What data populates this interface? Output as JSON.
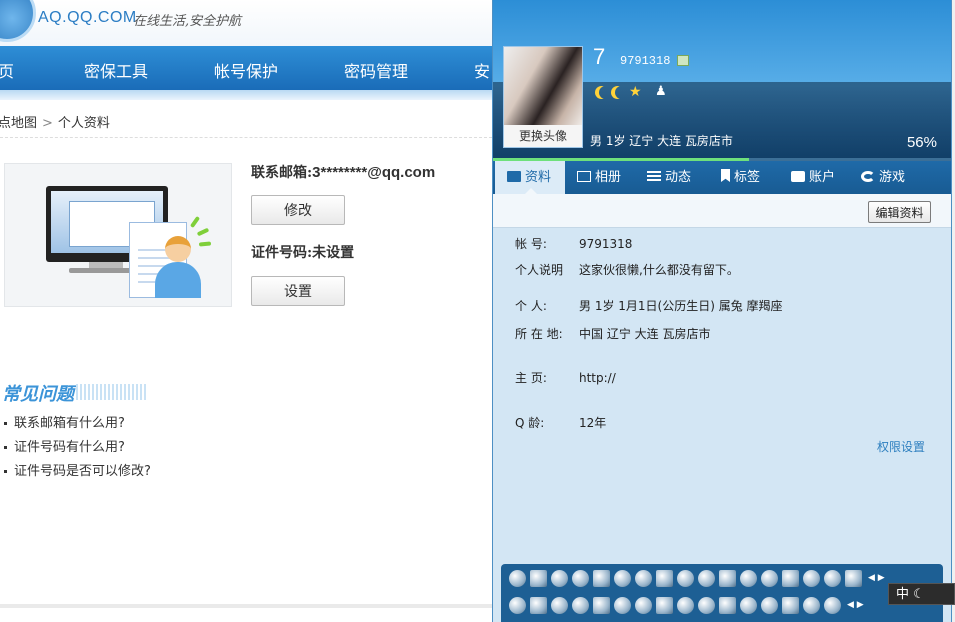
{
  "site": {
    "url_text": "AQ.QQ.COM",
    "slogan": "在线生活,安全护航",
    "nav": [
      "页",
      "密保工具",
      "帐号保护",
      "密码管理",
      "安"
    ],
    "breadcrumb": [
      "点地图",
      "个人资料"
    ],
    "breadcrumb_sep": ">",
    "email_label": "联系邮箱:",
    "email_value": "3********@qq.com",
    "modify_button": "修改",
    "id_label": "证件号码:",
    "id_value": "未设置",
    "set_button": "设置",
    "faq_title": "常见问题",
    "faq_items": [
      "联系邮箱有什么用?",
      "证件号码有什么用?",
      "证件号码是否可以修改?"
    ]
  },
  "profile": {
    "nickname": "7",
    "qq_number": "9791318",
    "change_avatar": "更换头像",
    "basic_info": "男  1岁   辽宁 大连 瓦房店市",
    "completeness": "56%",
    "completeness_value": 0.56,
    "tabs": [
      "资料",
      "相册",
      "动态",
      "标签",
      "账户",
      "游戏"
    ],
    "edit_button": "编辑资料",
    "fields": [
      {
        "key": "帐    号:",
        "value": "9791318"
      },
      {
        "key": "个人说明",
        "value": "这家伙很懒,什么都没有留下。"
      },
      {
        "key": "个    人:",
        "value": "男   1岁    1月1日(公历生日)   属兔   摩羯座"
      },
      {
        "key": "所 在 地:",
        "value": "中国 辽宁 大连 瓦房店市"
      },
      {
        "key": "主    页:",
        "value": "http://"
      },
      {
        "key": "Q    龄:",
        "value": "12年"
      }
    ],
    "permission_link": "权限设置"
  },
  "ime": {
    "label": "中"
  },
  "colors": {
    "accent": "#1f6aa8",
    "nav": "#2e8ed6",
    "panel_bg": "#d3e6f4",
    "progress": "#6ee07c"
  }
}
